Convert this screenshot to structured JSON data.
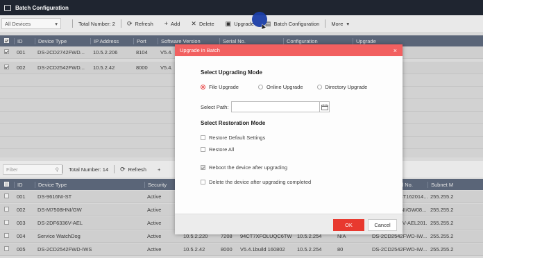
{
  "window": {
    "title": "Batch Configuration"
  },
  "toolbar_top": {
    "filter_value": "All Devices",
    "total": "Total Number: 2",
    "refresh": "Refresh",
    "add": "Add",
    "delete": "Delete",
    "upgrade": "Upgrade",
    "batch_config": "Batch Configuration",
    "more": "More"
  },
  "table_top": {
    "headers": [
      "ID",
      "Device Type",
      "IP Address",
      "Port",
      "Software Version",
      "Serial No.",
      "Configuration",
      "Upgrade"
    ],
    "rows": [
      {
        "id": "001",
        "type": "DS-2CD2742FWD...",
        "ip": "10.5.2.206",
        "port": "8104",
        "sw": "V5.4."
      },
      {
        "id": "002",
        "type": "DS-2CD2542FWD...",
        "ip": "10.5.2.42",
        "port": "8000",
        "sw": "V5.4."
      }
    ]
  },
  "toolbar_bottom": {
    "filter_placeholder": "Filter",
    "total": "Total Number: 14",
    "refresh": "Refresh",
    "add": "+"
  },
  "table_bottom": {
    "headers": [
      "ID",
      "Device Type",
      "Security",
      "",
      "",
      "",
      "",
      "",
      "Device Serial No.",
      "Subnet M"
    ],
    "rows": [
      {
        "id": "001",
        "type": "DS-9616NI-ST",
        "security": "Active",
        "ip": "",
        "port": "",
        "sn": "",
        "gw": "",
        "n": "",
        "serial": "DS-9616NI-ST162014...",
        "subnet": "255.255.2"
      },
      {
        "id": "002",
        "type": "DS-M7508HNI/GW",
        "security": "Active",
        "ip": "",
        "port": "",
        "sn": "",
        "gw": "",
        "n": "",
        "serial": "DS-M7508HNI/GW08...",
        "subnet": "255.255.2"
      },
      {
        "id": "003",
        "type": "DS-2DF6336V-AEL",
        "security": "Active",
        "ip": "",
        "port": "",
        "sn": "",
        "gw": "",
        "n": "",
        "serial": "DS-2DF6336V-AEL201...",
        "subnet": "255.255.2"
      },
      {
        "id": "004",
        "type": "Service WatchDog",
        "security": "Active",
        "ip": "10.5.2.220",
        "port": "7208",
        "sn": "94CT7XFOLUQC6TW",
        "gw": "10.5.2.254",
        "n": "N/A",
        "serial": "DS-2CD2542FWD-IW...",
        "subnet": "255.255.2"
      },
      {
        "id": "005",
        "type": "DS-2CD2542FWD-IWS",
        "security": "Active",
        "ip": "10.5.2.42",
        "port": "8000",
        "sn": "V5.4.1build 160802",
        "gw": "10.5.2.254",
        "n": "80",
        "serial": "DS-2CD2542FWD-IW...",
        "subnet": "255.255.2"
      }
    ]
  },
  "dialog": {
    "title": "Upgrade in Batch",
    "mode_heading": "Select Upgrading Mode",
    "modes": [
      "File Upgrade",
      "Online Upgrade",
      "Directory Upgrade"
    ],
    "selected_mode": "File Upgrade",
    "path_label": "Select Path:",
    "path_value": "",
    "restore_heading": "Select Restoration Mode",
    "restore_default": "Restore Default Settings",
    "restore_all": "Restore All",
    "reboot": "Reboot the device after upgrading",
    "delete_after": "Delete the device after upgrading completed",
    "ok": "OK",
    "cancel": "Cancel"
  },
  "colors": {
    "accent": "#e8392f",
    "title_bar": "#1f2530",
    "table_header": "#5a6578",
    "dialog_title": "#f26060"
  }
}
